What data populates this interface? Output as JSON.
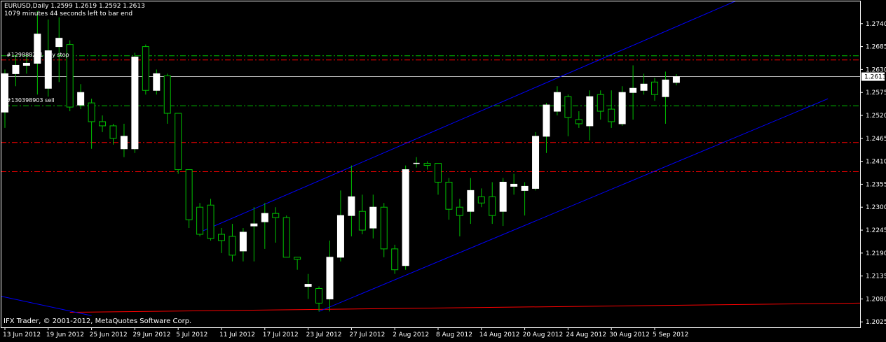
{
  "header": {
    "symbol_line": "EURUSD,Daily  1.2599 1.2619 1.2592 1.2613",
    "timer_line": "1079 minutes 44 seconds left to bar end"
  },
  "footer": {
    "copyright": "IFX Trader, © 2001-2012, MetaQuotes Software Corp."
  },
  "orders": [
    {
      "label": "#129888271 buy stop",
      "price": 1.2653,
      "color": "#ff0000",
      "style": "dash-dot"
    },
    {
      "label": "#130398903 sell",
      "price": 1.2543,
      "color": "#00c000",
      "style": "dash-dot"
    }
  ],
  "current_price_label": "1.2613",
  "colors": {
    "background": "#000000",
    "bull_candle": "#ffffff",
    "bear_candle": "#000000",
    "wick": "#00c000",
    "channel": "#0000ff",
    "red_level": "#ff0000",
    "green_level": "#00c000",
    "axis": "#ffffff"
  },
  "chart_data": {
    "type": "candlestick",
    "symbol": "EURUSD",
    "timeframe": "Daily",
    "y_ticks": [
      1.274,
      1.2685,
      1.263,
      1.2575,
      1.252,
      1.2465,
      1.241,
      1.2355,
      1.23,
      1.2245,
      1.219,
      1.2135,
      1.208,
      1.2025
    ],
    "ylim": [
      1.2012,
      1.2795
    ],
    "x_ticks": [
      "13 Jun 2012",
      "19 Jun 2012",
      "25 Jun 2012",
      "29 Jun 2012",
      "5 Jul 2012",
      "11 Jul 2012",
      "17 Jul 2012",
      "23 Jul 2012",
      "27 Jul 2012",
      "2 Aug 2012",
      "8 Aug 2012",
      "14 Aug 2012",
      "20 Aug 2012",
      "24 Aug 2012",
      "30 Aug 2012",
      "5 Sep 2012"
    ],
    "x_tick_bars": [
      0,
      4,
      8,
      12,
      16,
      20,
      24,
      28,
      32,
      36,
      40,
      44,
      48,
      52,
      56,
      60
    ],
    "bars": [
      {
        "o": 1.2528,
        "h": 1.263,
        "l": 1.249,
        "c": 1.262
      },
      {
        "o": 1.262,
        "h": 1.266,
        "l": 1.259,
        "c": 1.264
      },
      {
        "o": 1.264,
        "h": 1.266,
        "l": 1.262,
        "c": 1.2645
      },
      {
        "o": 1.2645,
        "h": 1.277,
        "l": 1.257,
        "c": 1.2715
      },
      {
        "o": 1.2585,
        "h": 1.275,
        "l": 1.2565,
        "c": 1.2675
      },
      {
        "o": 1.2685,
        "h": 1.2755,
        "l": 1.26,
        "c": 1.2705
      },
      {
        "o": 1.269,
        "h": 1.27,
        "l": 1.253,
        "c": 1.254
      },
      {
        "o": 1.2545,
        "h": 1.2595,
        "l": 1.2535,
        "c": 1.2575
      },
      {
        "o": 1.255,
        "h": 1.256,
        "l": 1.244,
        "c": 1.2505
      },
      {
        "o": 1.2505,
        "h": 1.252,
        "l": 1.248,
        "c": 1.2495
      },
      {
        "o": 1.2495,
        "h": 1.25,
        "l": 1.245,
        "c": 1.2465
      },
      {
        "o": 1.244,
        "h": 1.25,
        "l": 1.242,
        "c": 1.247
      },
      {
        "o": 1.244,
        "h": 1.267,
        "l": 1.243,
        "c": 1.266
      },
      {
        "o": 1.2685,
        "h": 1.269,
        "l": 1.257,
        "c": 1.258
      },
      {
        "o": 1.258,
        "h": 1.263,
        "l": 1.257,
        "c": 1.262
      },
      {
        "o": 1.2615,
        "h": 1.262,
        "l": 1.25,
        "c": 1.2525
      },
      {
        "o": 1.2525,
        "h": 1.2525,
        "l": 1.238,
        "c": 1.239
      },
      {
        "o": 1.239,
        "h": 1.239,
        "l": 1.225,
        "c": 1.227
      },
      {
        "o": 1.23,
        "h": 1.231,
        "l": 1.223,
        "c": 1.2235
      },
      {
        "o": 1.2305,
        "h": 1.232,
        "l": 1.222,
        "c": 1.2225
      },
      {
        "o": 1.2235,
        "h": 1.225,
        "l": 1.219,
        "c": 1.222
      },
      {
        "o": 1.223,
        "h": 1.226,
        "l": 1.217,
        "c": 1.2185
      },
      {
        "o": 1.2195,
        "h": 1.225,
        "l": 1.217,
        "c": 1.224
      },
      {
        "o": 1.2255,
        "h": 1.23,
        "l": 1.217,
        "c": 1.226
      },
      {
        "o": 1.2265,
        "h": 1.231,
        "l": 1.22,
        "c": 1.2285
      },
      {
        "o": 1.2285,
        "h": 1.23,
        "l": 1.2215,
        "c": 1.2275
      },
      {
        "o": 1.2275,
        "h": 1.228,
        "l": 1.219,
        "c": 1.218
      },
      {
        "o": 1.218,
        "h": 1.218,
        "l": 1.215,
        "c": 1.2175
      },
      {
        "o": 1.211,
        "h": 1.214,
        "l": 1.208,
        "c": 1.2115
      },
      {
        "o": 1.2105,
        "h": 1.211,
        "l": 1.205,
        "c": 1.207
      },
      {
        "o": 1.208,
        "h": 1.222,
        "l": 1.205,
        "c": 1.218
      },
      {
        "o": 1.218,
        "h": 1.234,
        "l": 1.217,
        "c": 1.228
      },
      {
        "o": 1.228,
        "h": 1.24,
        "l": 1.223,
        "c": 1.2325
      },
      {
        "o": 1.229,
        "h": 1.233,
        "l": 1.2235,
        "c": 1.2245
      },
      {
        "o": 1.225,
        "h": 1.233,
        "l": 1.2225,
        "c": 1.23
      },
      {
        "o": 1.23,
        "h": 1.231,
        "l": 1.218,
        "c": 1.22
      },
      {
        "o": 1.22,
        "h": 1.221,
        "l": 1.214,
        "c": 1.215
      },
      {
        "o": 1.216,
        "h": 1.24,
        "l": 1.215,
        "c": 1.239
      },
      {
        "o": 1.2405,
        "h": 1.242,
        "l": 1.2395,
        "c": 1.2405
      },
      {
        "o": 1.2405,
        "h": 1.241,
        "l": 1.239,
        "c": 1.24
      },
      {
        "o": 1.2405,
        "h": 1.2405,
        "l": 1.233,
        "c": 1.236
      },
      {
        "o": 1.236,
        "h": 1.237,
        "l": 1.227,
        "c": 1.2295
      },
      {
        "o": 1.23,
        "h": 1.232,
        "l": 1.223,
        "c": 1.228
      },
      {
        "o": 1.229,
        "h": 1.237,
        "l": 1.226,
        "c": 1.234
      },
      {
        "o": 1.2325,
        "h": 1.2345,
        "l": 1.23,
        "c": 1.231
      },
      {
        "o": 1.2325,
        "h": 1.236,
        "l": 1.226,
        "c": 1.228
      },
      {
        "o": 1.229,
        "h": 1.237,
        "l": 1.2255,
        "c": 1.236
      },
      {
        "o": 1.235,
        "h": 1.238,
        "l": 1.233,
        "c": 1.2355
      },
      {
        "o": 1.234,
        "h": 1.236,
        "l": 1.228,
        "c": 1.235
      },
      {
        "o": 1.2345,
        "h": 1.248,
        "l": 1.234,
        "c": 1.247
      },
      {
        "o": 1.247,
        "h": 1.255,
        "l": 1.243,
        "c": 1.2545
      },
      {
        "o": 1.253,
        "h": 1.259,
        "l": 1.252,
        "c": 1.2575
      },
      {
        "o": 1.2565,
        "h": 1.257,
        "l": 1.247,
        "c": 1.2515
      },
      {
        "o": 1.251,
        "h": 1.253,
        "l": 1.249,
        "c": 1.25
      },
      {
        "o": 1.2495,
        "h": 1.258,
        "l": 1.246,
        "c": 1.2565
      },
      {
        "o": 1.257,
        "h": 1.258,
        "l": 1.251,
        "c": 1.253
      },
      {
        "o": 1.2535,
        "h": 1.258,
        "l": 1.249,
        "c": 1.2505
      },
      {
        "o": 1.25,
        "h": 1.259,
        "l": 1.2495,
        "c": 1.2575
      },
      {
        "o": 1.2575,
        "h": 1.264,
        "l": 1.251,
        "c": 1.2585
      },
      {
        "o": 1.258,
        "h": 1.262,
        "l": 1.257,
        "c": 1.2595
      },
      {
        "o": 1.26,
        "h": 1.261,
        "l": 1.2555,
        "c": 1.257
      },
      {
        "o": 1.2565,
        "h": 1.2625,
        "l": 1.25,
        "c": 1.2605
      },
      {
        "o": 1.2599,
        "h": 1.2619,
        "l": 1.2592,
        "c": 1.2613
      }
    ],
    "levels": [
      {
        "price": 1.2653,
        "color": "#ff0000",
        "style": "dash-dot"
      },
      {
        "price": 1.2663,
        "color": "#00c000",
        "style": "dash-dot"
      },
      {
        "price": 1.2543,
        "color": "#00c000",
        "style": "dash-dot"
      },
      {
        "price": 1.2455,
        "color": "#ff0000",
        "style": "dash-dot"
      },
      {
        "price": 1.2385,
        "color": "#ff0000",
        "style": "dash-dot"
      }
    ],
    "current_price": 1.2613,
    "channel_lines": [
      {
        "from": [
          18,
          1.224
        ],
        "to": [
          68,
          1.28
        ],
        "color": "#0000ff"
      },
      {
        "from": [
          29,
          1.205
        ],
        "to": [
          76,
          1.256
        ],
        "color": "#0000ff"
      },
      {
        "from": [
          -1,
          1.209
        ],
        "to": [
          8,
          1.204
        ],
        "color": "#0000ff"
      }
    ],
    "moving_average": {
      "from": [
        6,
        1.2048
      ],
      "to": [
        76,
        1.207
      ],
      "color": "#ff0000"
    }
  }
}
